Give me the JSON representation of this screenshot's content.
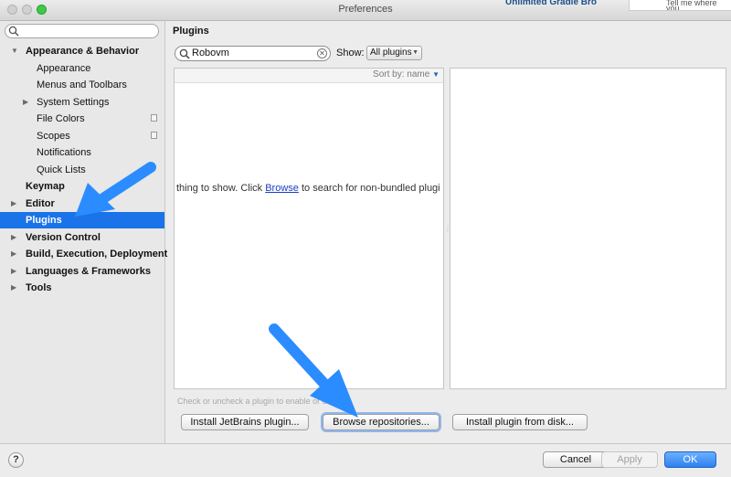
{
  "window": {
    "title": "Preferences"
  },
  "background": {
    "app_title": "Unlimited Gradle Bro",
    "popup_text": "Tell me where you"
  },
  "sidebar": {
    "search": {
      "value": ""
    },
    "items": [
      {
        "label": "Appearance & Behavior",
        "level": 0,
        "bold": true,
        "expanded": true,
        "has_children": true
      },
      {
        "label": "Appearance",
        "level": 1
      },
      {
        "label": "Menus and Toolbars",
        "level": 1
      },
      {
        "label": "System Settings",
        "level": 1,
        "has_children": true
      },
      {
        "label": "File Colors",
        "level": 1,
        "project_icon": true
      },
      {
        "label": "Scopes",
        "level": 1,
        "project_icon": true
      },
      {
        "label": "Notifications",
        "level": 1
      },
      {
        "label": "Quick Lists",
        "level": 1
      },
      {
        "label": "Keymap",
        "level": 0,
        "bold": true
      },
      {
        "label": "Editor",
        "level": 0,
        "bold": true,
        "has_children": true
      },
      {
        "label": "Plugins",
        "level": 0,
        "bold": true,
        "selected": true
      },
      {
        "label": "Version Control",
        "level": 0,
        "bold": true,
        "has_children": true
      },
      {
        "label": "Build, Execution, Deployment",
        "level": 0,
        "bold": true,
        "has_children": true
      },
      {
        "label": "Languages & Frameworks",
        "level": 0,
        "bold": true,
        "has_children": true
      },
      {
        "label": "Tools",
        "level": 0,
        "bold": true,
        "has_children": true
      }
    ]
  },
  "plugins": {
    "heading": "Plugins",
    "search_value": "Robovm",
    "show_label": "Show:",
    "show_value": "All plugins",
    "sort_label": "Sort by: name",
    "empty_before": "thing to show. Click ",
    "empty_link": "Browse",
    "empty_after": " to search for non-bundled plugi",
    "hint": "Check or uncheck a plugin to enable or d"
  },
  "buttons": {
    "install_jetbrains": "Install JetBrains plugin...",
    "browse_repos": "Browse repositories...",
    "install_disk": "Install plugin from disk...",
    "help": "?",
    "cancel": "Cancel",
    "apply": "Apply",
    "ok": "OK"
  },
  "icons": {
    "search": "search-icon",
    "clear": "clear-icon",
    "help": "help-icon",
    "annotation": "arrow-pointer-icon"
  },
  "colors": {
    "selection": "#1a73e8",
    "annotation": "#2b8cff",
    "link": "#1b3fbf"
  }
}
